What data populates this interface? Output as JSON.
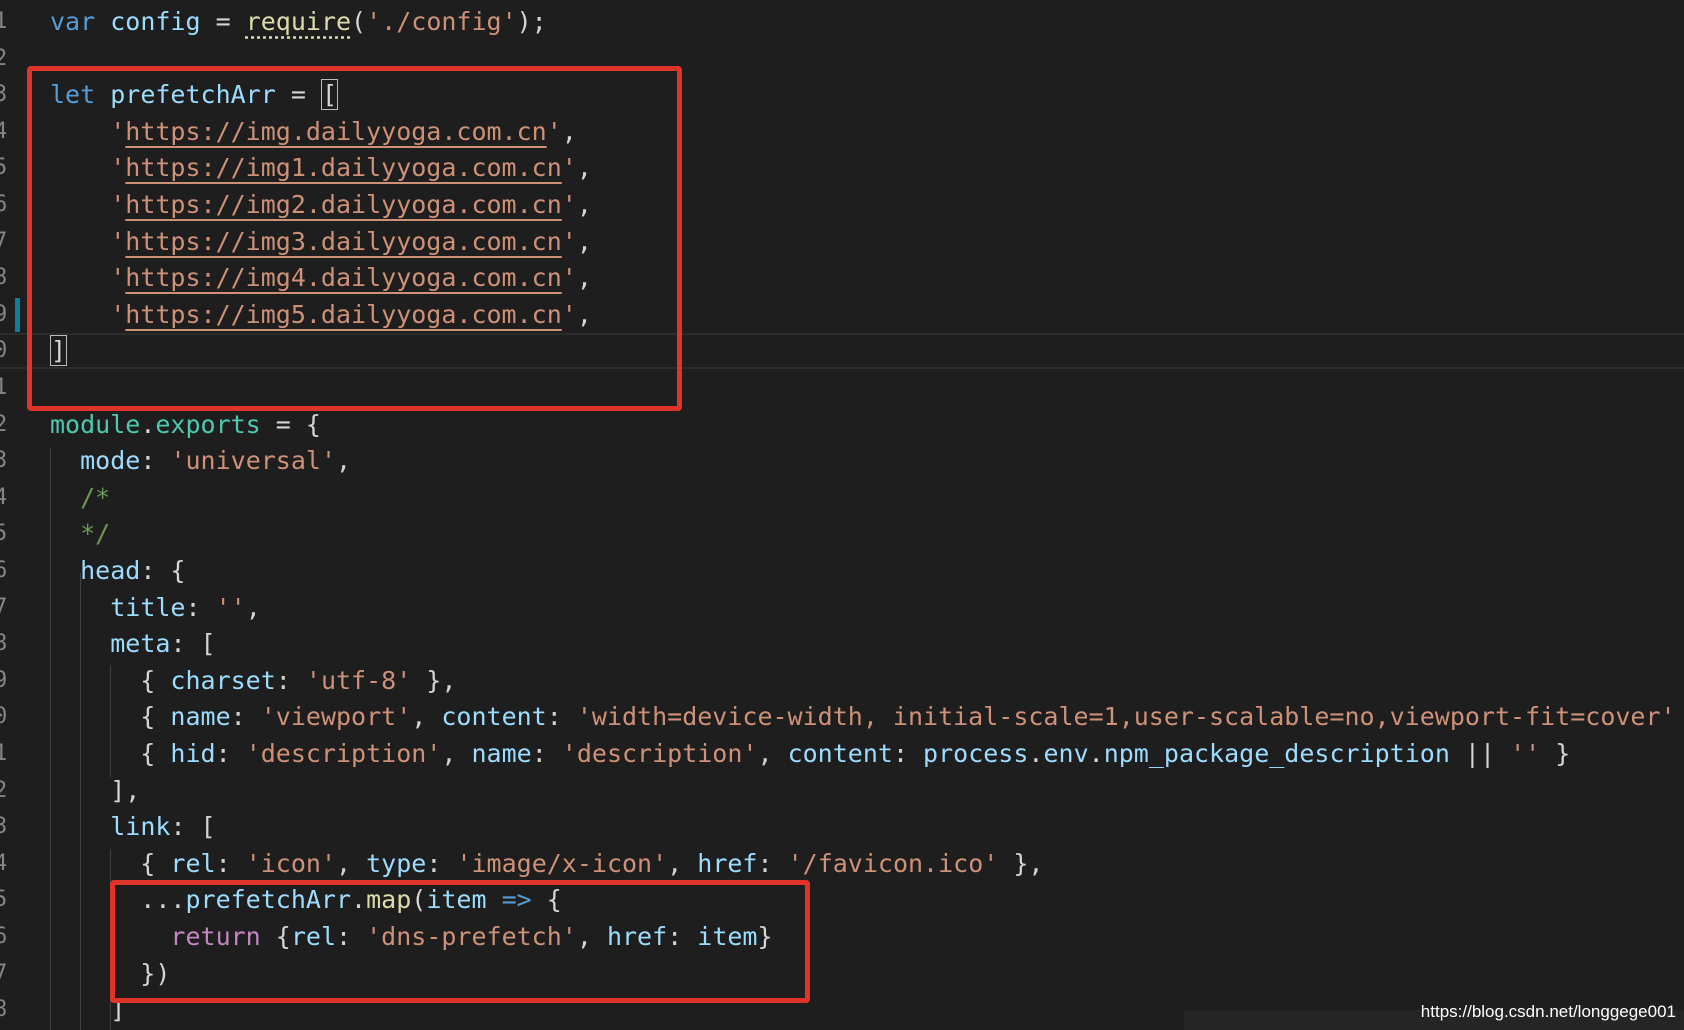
{
  "editor": {
    "line_numbers": [
      "1",
      "2",
      "3",
      "4",
      "5",
      "6",
      "7",
      "8",
      "9",
      "0",
      "1",
      "2",
      "3",
      "4",
      "5",
      "6",
      "7",
      "8",
      "9",
      "0",
      "1",
      "2",
      "3",
      "4",
      "5",
      "6",
      "7",
      "8"
    ],
    "lines": [
      {
        "segments": [
          {
            "t": "var ",
            "c": "kw"
          },
          {
            "t": "config",
            "c": "var"
          },
          {
            "t": " = "
          },
          {
            "t": "require",
            "c": "fn dots"
          },
          {
            "t": "("
          },
          {
            "t": "'./config'",
            "c": "str"
          },
          {
            "t": ");"
          }
        ]
      },
      {
        "segments": []
      },
      {
        "segments": [
          {
            "t": "let ",
            "c": "kw"
          },
          {
            "t": "prefetchArr",
            "c": "var"
          },
          {
            "t": " = "
          },
          {
            "t": "[",
            "c": "cursor-box"
          }
        ]
      },
      {
        "segments": [
          {
            "t": "    '",
            "c": "str"
          },
          {
            "t": "https://img.dailyyoga.com.cn",
            "c": "str url"
          },
          {
            "t": "'",
            "c": "str"
          },
          {
            "t": ","
          }
        ]
      },
      {
        "segments": [
          {
            "t": "    '",
            "c": "str"
          },
          {
            "t": "https://img1.dailyyoga.com.cn",
            "c": "str url"
          },
          {
            "t": "'",
            "c": "str"
          },
          {
            "t": ","
          }
        ]
      },
      {
        "segments": [
          {
            "t": "    '",
            "c": "str"
          },
          {
            "t": "https://img2.dailyyoga.com.cn",
            "c": "str url"
          },
          {
            "t": "'",
            "c": "str"
          },
          {
            "t": ","
          }
        ]
      },
      {
        "segments": [
          {
            "t": "    '",
            "c": "str"
          },
          {
            "t": "https://img3.dailyyoga.com.cn",
            "c": "str url"
          },
          {
            "t": "'",
            "c": "str"
          },
          {
            "t": ","
          }
        ]
      },
      {
        "segments": [
          {
            "t": "    '",
            "c": "str"
          },
          {
            "t": "https://img4.dailyyoga.com.cn",
            "c": "str url"
          },
          {
            "t": "'",
            "c": "str"
          },
          {
            "t": ","
          }
        ]
      },
      {
        "segments": [
          {
            "t": "    '",
            "c": "str"
          },
          {
            "t": "https://img5.dailyyoga.com.cn",
            "c": "str url"
          },
          {
            "t": "'",
            "c": "str"
          },
          {
            "t": ","
          }
        ]
      },
      {
        "segments": [
          {
            "t": "]",
            "c": "cursor-box"
          }
        ]
      },
      {
        "segments": []
      },
      {
        "segments": [
          {
            "t": "module",
            "c": "obj"
          },
          {
            "t": "."
          },
          {
            "t": "exports",
            "c": "obj"
          },
          {
            "t": " = {"
          }
        ]
      },
      {
        "segments": [
          {
            "t": "  "
          },
          {
            "t": "mode",
            "c": "prop"
          },
          {
            "t": ": "
          },
          {
            "t": "'universal'",
            "c": "str"
          },
          {
            "t": ","
          }
        ]
      },
      {
        "segments": [
          {
            "t": "  "
          },
          {
            "t": "/*",
            "c": "cmt"
          }
        ]
      },
      {
        "segments": [
          {
            "t": "  "
          },
          {
            "t": "*/",
            "c": "cmt"
          }
        ]
      },
      {
        "segments": [
          {
            "t": "  "
          },
          {
            "t": "head",
            "c": "prop"
          },
          {
            "t": ": {"
          }
        ]
      },
      {
        "segments": [
          {
            "t": "    "
          },
          {
            "t": "title",
            "c": "prop"
          },
          {
            "t": ": "
          },
          {
            "t": "''",
            "c": "str"
          },
          {
            "t": ","
          }
        ]
      },
      {
        "segments": [
          {
            "t": "    "
          },
          {
            "t": "meta",
            "c": "prop"
          },
          {
            "t": ": ["
          }
        ]
      },
      {
        "segments": [
          {
            "t": "      { "
          },
          {
            "t": "charset",
            "c": "prop"
          },
          {
            "t": ": "
          },
          {
            "t": "'utf-8'",
            "c": "str"
          },
          {
            "t": " },"
          }
        ]
      },
      {
        "segments": [
          {
            "t": "      { "
          },
          {
            "t": "name",
            "c": "prop"
          },
          {
            "t": ": "
          },
          {
            "t": "'viewport'",
            "c": "str"
          },
          {
            "t": ", "
          },
          {
            "t": "content",
            "c": "prop"
          },
          {
            "t": ": "
          },
          {
            "t": "'width=device-width, initial-scale=1,user-scalable=no,viewport-fit=cover'",
            "c": "str"
          },
          {
            "t": " },"
          }
        ]
      },
      {
        "segments": [
          {
            "t": "      { "
          },
          {
            "t": "hid",
            "c": "prop"
          },
          {
            "t": ": "
          },
          {
            "t": "'description'",
            "c": "str"
          },
          {
            "t": ", "
          },
          {
            "t": "name",
            "c": "prop"
          },
          {
            "t": ": "
          },
          {
            "t": "'description'",
            "c": "str"
          },
          {
            "t": ", "
          },
          {
            "t": "content",
            "c": "prop"
          },
          {
            "t": ": "
          },
          {
            "t": "process",
            "c": "var"
          },
          {
            "t": "."
          },
          {
            "t": "env",
            "c": "var"
          },
          {
            "t": "."
          },
          {
            "t": "npm_package_description",
            "c": "var"
          },
          {
            "t": " || "
          },
          {
            "t": "''",
            "c": "str"
          },
          {
            "t": " }"
          }
        ]
      },
      {
        "segments": [
          {
            "t": "    ],"
          }
        ]
      },
      {
        "segments": [
          {
            "t": "    "
          },
          {
            "t": "link",
            "c": "prop"
          },
          {
            "t": ": ["
          }
        ]
      },
      {
        "segments": [
          {
            "t": "      { "
          },
          {
            "t": "rel",
            "c": "prop"
          },
          {
            "t": ": "
          },
          {
            "t": "'icon'",
            "c": "str"
          },
          {
            "t": ", "
          },
          {
            "t": "type",
            "c": "prop"
          },
          {
            "t": ": "
          },
          {
            "t": "'image/x-icon'",
            "c": "str"
          },
          {
            "t": ", "
          },
          {
            "t": "href",
            "c": "prop"
          },
          {
            "t": ": "
          },
          {
            "t": "'/favicon.ico'",
            "c": "str"
          },
          {
            "t": " },"
          }
        ]
      },
      {
        "segments": [
          {
            "t": "      ..."
          },
          {
            "t": "prefetchArr",
            "c": "var"
          },
          {
            "t": "."
          },
          {
            "t": "map",
            "c": "fn"
          },
          {
            "t": "("
          },
          {
            "t": "item",
            "c": "var"
          },
          {
            "t": " "
          },
          {
            "t": "=>",
            "c": "kw"
          },
          {
            "t": " {"
          }
        ]
      },
      {
        "segments": [
          {
            "t": "        "
          },
          {
            "t": "return",
            "c": "kw2"
          },
          {
            "t": " {"
          },
          {
            "t": "rel",
            "c": "prop"
          },
          {
            "t": ": "
          },
          {
            "t": "'dns-prefetch'",
            "c": "str"
          },
          {
            "t": ", "
          },
          {
            "t": "href",
            "c": "prop"
          },
          {
            "t": ": "
          },
          {
            "t": "item",
            "c": "var"
          },
          {
            "t": "}"
          }
        ]
      },
      {
        "segments": [
          {
            "t": "      })"
          }
        ]
      },
      {
        "segments": [
          {
            "t": "    ]"
          }
        ]
      }
    ]
  },
  "watermark": "https://blog.csdn.net/longgege001"
}
